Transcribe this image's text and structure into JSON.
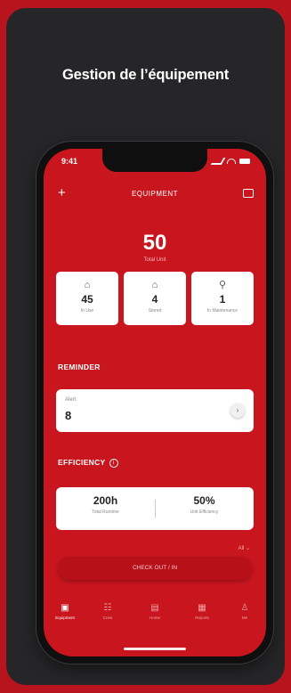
{
  "page": {
    "heading": "Gestion de l’équipement"
  },
  "status_bar": {
    "time": "9:41"
  },
  "header": {
    "title": "EQUIPMENT",
    "add_icon": "plus-icon",
    "message_icon": "message-icon"
  },
  "totals": {
    "value": "50",
    "label": "Total Unit"
  },
  "stats": [
    {
      "icon": "home-icon",
      "value": "45",
      "label": "In Use"
    },
    {
      "icon": "home-icon",
      "value": "4",
      "label": "Stored"
    },
    {
      "icon": "wrench-icon",
      "value": "1",
      "label": "In Maintenance"
    }
  ],
  "reminder": {
    "title": "REMINDER",
    "alert_label": "Alert",
    "alert_value": "8"
  },
  "efficiency": {
    "title": "EFFICIENCY",
    "items": [
      {
        "value": "200h",
        "label": "Total Runtime"
      },
      {
        "value": "50%",
        "label": "Unit Efficiency"
      }
    ],
    "filter": "All"
  },
  "checkout": {
    "label": "CHECK OUT / IN"
  },
  "tabs": [
    {
      "label": "Equipment",
      "icon": "equipment-icon"
    },
    {
      "label": "Crew",
      "icon": "people-icon"
    },
    {
      "label": "Home",
      "icon": "calendar-icon"
    },
    {
      "label": "Reports",
      "icon": "chart-icon"
    },
    {
      "label": "Me",
      "icon": "person-icon"
    }
  ],
  "colors": {
    "brand_red": "#c8151e",
    "background_red": "#b8141d",
    "card": "#262628"
  }
}
